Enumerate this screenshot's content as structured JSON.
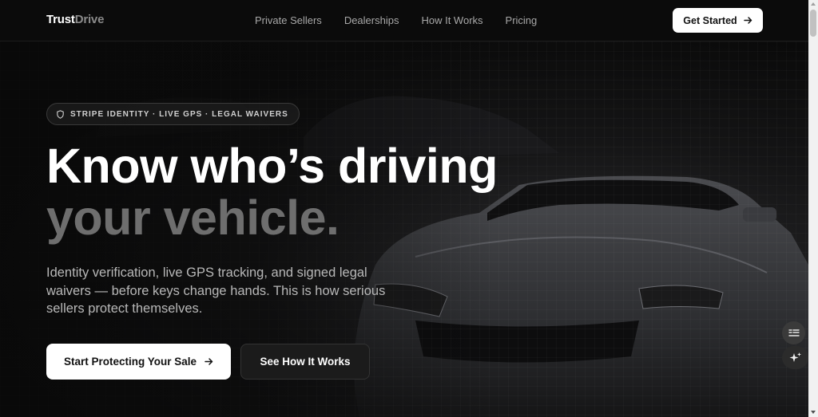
{
  "brand": {
    "part1": "Trust",
    "part2": "Drive"
  },
  "nav": {
    "links": [
      "Private Sellers",
      "Dealerships",
      "How It Works",
      "Pricing"
    ],
    "cta_label": "Get Started"
  },
  "hero": {
    "badge": "STRIPE IDENTITY · LIVE GPS · LEGAL WAIVERS",
    "headline_line1": "Know who’s driving",
    "headline_line2": "your vehicle.",
    "subtitle": "Identity verification, live GPS tracking, and signed legal waivers — before keys change hands. This is how serious sellers protect themselves.",
    "primary_cta": "Start Protecting Your Sale",
    "secondary_cta": "See How It Works"
  },
  "icons": {
    "badge_icon": "shield-icon",
    "arrow": "arrow-right-icon",
    "fab_top": "notes-icon",
    "fab_bottom": "sparkles-icon"
  },
  "colors": {
    "background": "#090909",
    "accent": "#ffffff",
    "muted": "#6e6e6e"
  }
}
